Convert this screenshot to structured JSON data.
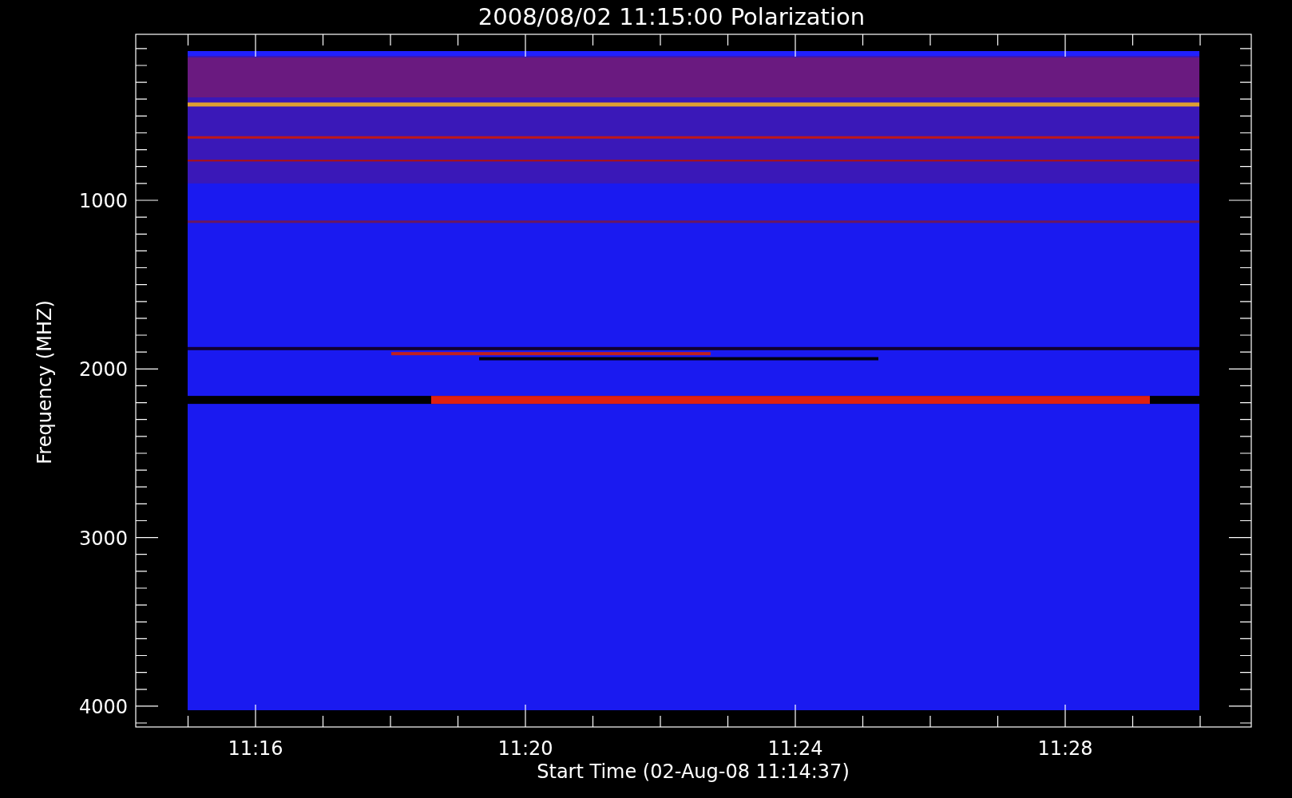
{
  "plot": {
    "title": "2008/08/02 11:15:00 Polarization",
    "xlabel": "Start Time (02-Aug-08 11:14:37)",
    "ylabel": "Frequency (MHZ)",
    "xticks": [
      "11:16",
      "11:20",
      "11:24",
      "11:28"
    ],
    "yticks": [
      "1000",
      "2000",
      "3000",
      "4000"
    ]
  }
}
